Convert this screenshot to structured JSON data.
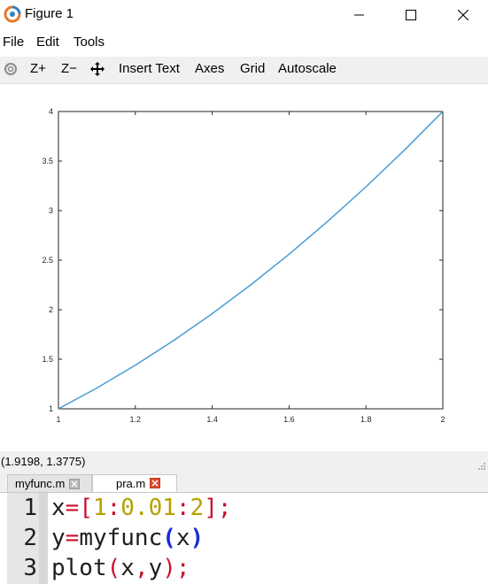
{
  "window": {
    "title": "Figure 1",
    "icon": "octave-logo-icon",
    "controls": [
      "minimize-icon",
      "maximize-icon",
      "close-icon"
    ]
  },
  "menu": {
    "items": [
      "File",
      "Edit",
      "Tools"
    ]
  },
  "toolbar": {
    "rotate_icon": "rotate-icon",
    "zoom_in": "Z+",
    "zoom_out": "Z−",
    "pan_icon": "pan-move-icon",
    "insert_text": "Insert Text",
    "axes": "Axes",
    "grid": "Grid",
    "autoscale": "Autoscale"
  },
  "chart_data": {
    "type": "line",
    "title": "",
    "xlabel": "",
    "ylabel": "",
    "xlim": [
      1,
      2
    ],
    "ylim": [
      1,
      4
    ],
    "grid": false,
    "x_ticks": [
      "1",
      "1.2",
      "1.4",
      "1.6",
      "1.8",
      "2"
    ],
    "y_ticks": [
      "1",
      "1.5",
      "2",
      "2.5",
      "3",
      "3.5",
      "4"
    ],
    "x_tick_values": [
      1,
      1.2,
      1.4,
      1.6,
      1.8,
      2
    ],
    "y_tick_values": [
      1,
      1.5,
      2,
      2.5,
      3,
      3.5,
      4
    ],
    "series": [
      {
        "color": "#4a9bd4",
        "x": [
          1.0,
          1.1,
          1.2,
          1.3,
          1.4,
          1.5,
          1.6,
          1.7,
          1.8,
          1.9,
          2.0
        ],
        "y": [
          1.0,
          1.21,
          1.44,
          1.69,
          1.96,
          2.25,
          2.56,
          2.89,
          3.24,
          3.61,
          4.0
        ]
      }
    ]
  },
  "status": {
    "coordinates": "(1.9198, 1.3775)"
  },
  "editor": {
    "tabs": [
      {
        "label": "myfunc.m",
        "active": false
      },
      {
        "label": "pra.m",
        "active": true
      }
    ],
    "line_numbers": [
      "1",
      "2",
      "3"
    ],
    "lines": [
      [
        {
          "t": "x",
          "k": "id"
        },
        {
          "t": "=",
          "k": "op"
        },
        {
          "t": "[",
          "k": "op"
        },
        {
          "t": "1",
          "k": "num"
        },
        {
          "t": ":",
          "k": "op"
        },
        {
          "t": "0.01",
          "k": "num"
        },
        {
          "t": ":",
          "k": "op"
        },
        {
          "t": "2",
          "k": "num"
        },
        {
          "t": "]",
          "k": "op"
        },
        {
          "t": ";",
          "k": "punct"
        }
      ],
      [
        {
          "t": "y",
          "k": "id"
        },
        {
          "t": "=",
          "k": "op"
        },
        {
          "t": "myfunc",
          "k": "id"
        },
        {
          "t": "(",
          "k": "paren"
        },
        {
          "t": "x",
          "k": "id"
        },
        {
          "t": ")",
          "k": "paren"
        }
      ],
      [
        {
          "t": "plot",
          "k": "id"
        },
        {
          "t": "(",
          "k": "op"
        },
        {
          "t": "x",
          "k": "id"
        },
        {
          "t": ",",
          "k": "op"
        },
        {
          "t": "y",
          "k": "id"
        },
        {
          "t": ")",
          "k": "op"
        },
        {
          "t": ";",
          "k": "punct"
        }
      ]
    ]
  }
}
